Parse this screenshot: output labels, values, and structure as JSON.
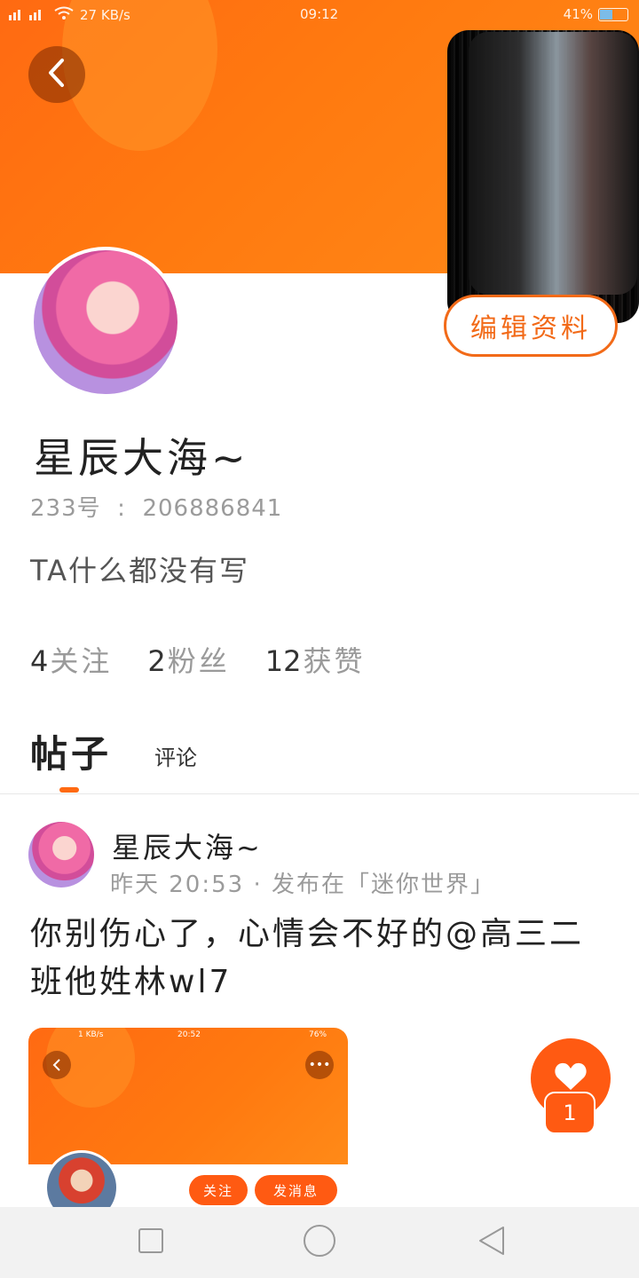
{
  "status_bar": {
    "network_speed": "27 KB/s",
    "time": "09:12",
    "battery": "41%"
  },
  "profile": {
    "username": "星辰大海~",
    "id_label": "233号",
    "id_value": "206886841",
    "bio": "TA什么都没有写",
    "edit_button": "编辑资料",
    "stats": [
      {
        "num": "4",
        "label": "关注"
      },
      {
        "num": "2",
        "label": "粉丝"
      },
      {
        "num": "12",
        "label": "获赞"
      }
    ]
  },
  "tabs": {
    "active": "帖子",
    "other": "评论"
  },
  "post": {
    "author": "星辰大海~",
    "meta": "昨天 20:53 · 发布在「迷你世界」",
    "text": "你别伤心了，心情会不好的@高三二班他姓林wl7",
    "image": {
      "status_speed": "1 KB/s",
      "status_time": "20:52",
      "status_battery": "76%",
      "follow_button": "关注",
      "message_button": "发消息"
    }
  },
  "like": {
    "count": "1"
  },
  "colors": {
    "accent": "#ff6a12",
    "accent_dark": "#f26a18"
  }
}
